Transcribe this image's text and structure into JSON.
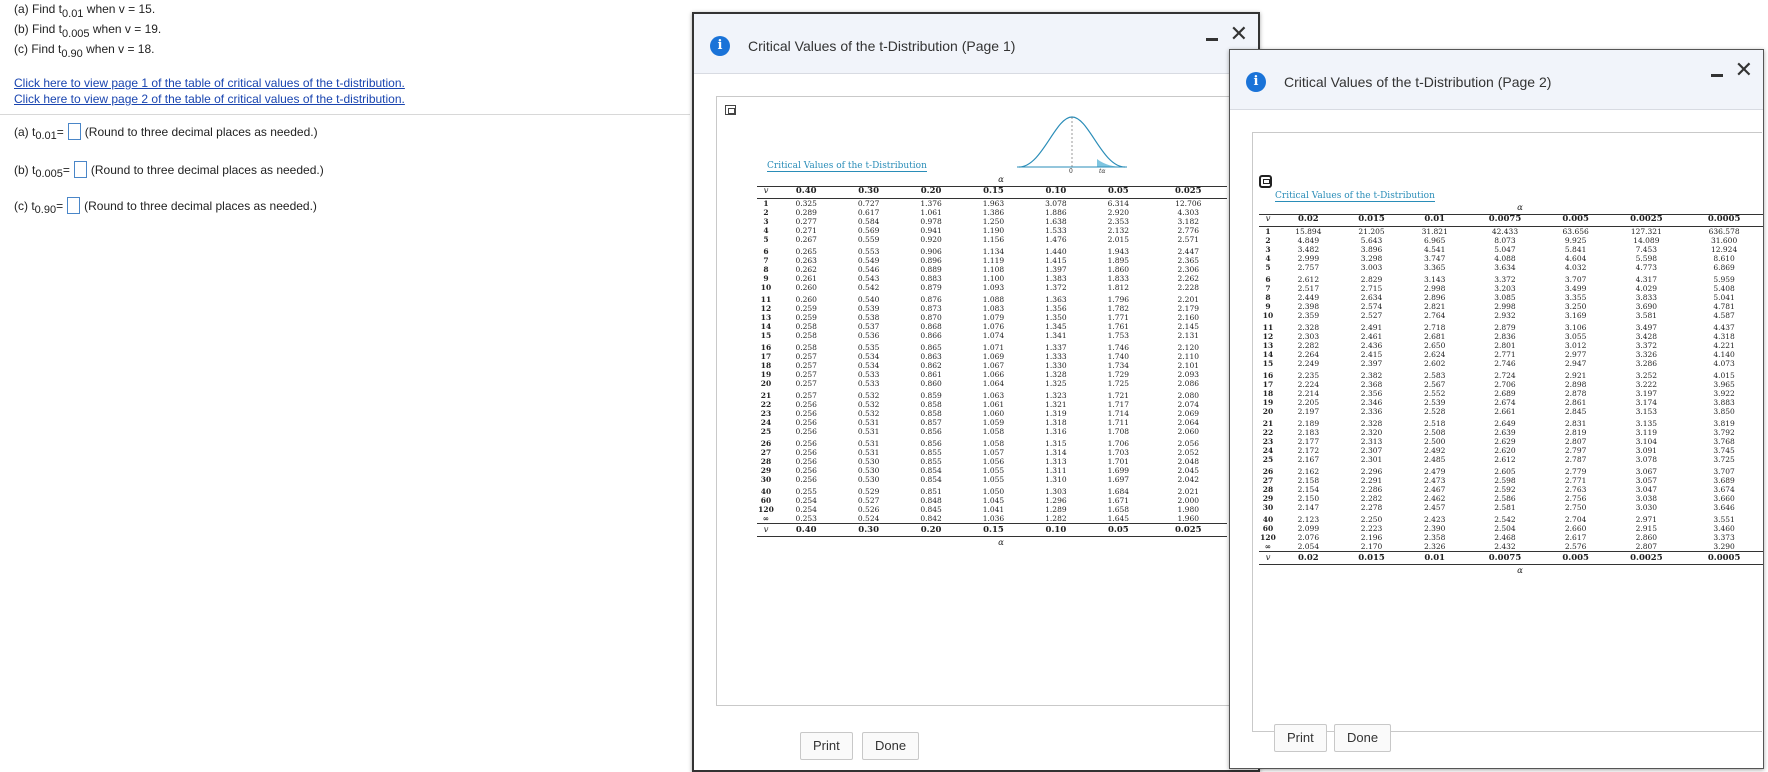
{
  "questions": [
    {
      "prefix": "(a) Find t",
      "sub": "0.01",
      "suffix": " when v = 15."
    },
    {
      "prefix": "(b) Find t",
      "sub": "0.005",
      "suffix": " when v = 19."
    },
    {
      "prefix": "(c) Find t",
      "sub": "0.90",
      "suffix": " when v = 18."
    }
  ],
  "links": [
    "Click here to view page 1 of the table of critical values of the t-distribution.",
    "Click here to view page 2 of the table of critical values of the t-distribution."
  ],
  "answers": [
    {
      "prefix": "(a) t",
      "sub": "0.01",
      "eq": " =",
      "hint": "(Round to three decimal places as needed.)"
    },
    {
      "prefix": "(b) t",
      "sub": "0.005",
      "eq": " =",
      "hint": "(Round to three decimal places as needed.)"
    },
    {
      "prefix": "(c) t",
      "sub": "0.90",
      "eq": " =",
      "hint": "(Round to three decimal places as needed.)"
    }
  ],
  "dialog1": {
    "title": "Critical Values of the t-Distribution (Page 1)",
    "caption": "Critical Values of the t-Distribution",
    "alpha_label": "α",
    "nu_label": "v",
    "curve_labels": [
      "0",
      "tα"
    ],
    "columns": [
      "0.40",
      "0.30",
      "0.20",
      "0.15",
      "0.10",
      "0.05",
      "0.025"
    ],
    "rows": [
      [
        "1",
        "0.325",
        "0.727",
        "1.376",
        "1.963",
        "3.078",
        "6.314",
        "12.706"
      ],
      [
        "2",
        "0.289",
        "0.617",
        "1.061",
        "1.386",
        "1.886",
        "2.920",
        "4.303"
      ],
      [
        "3",
        "0.277",
        "0.584",
        "0.978",
        "1.250",
        "1.638",
        "2.353",
        "3.182"
      ],
      [
        "4",
        "0.271",
        "0.569",
        "0.941",
        "1.190",
        "1.533",
        "2.132",
        "2.776"
      ],
      [
        "5",
        "0.267",
        "0.559",
        "0.920",
        "1.156",
        "1.476",
        "2.015",
        "2.571"
      ],
      [
        "6",
        "0.265",
        "0.553",
        "0.906",
        "1.134",
        "1.440",
        "1.943",
        "2.447"
      ],
      [
        "7",
        "0.263",
        "0.549",
        "0.896",
        "1.119",
        "1.415",
        "1.895",
        "2.365"
      ],
      [
        "8",
        "0.262",
        "0.546",
        "0.889",
        "1.108",
        "1.397",
        "1.860",
        "2.306"
      ],
      [
        "9",
        "0.261",
        "0.543",
        "0.883",
        "1.100",
        "1.383",
        "1.833",
        "2.262"
      ],
      [
        "10",
        "0.260",
        "0.542",
        "0.879",
        "1.093",
        "1.372",
        "1.812",
        "2.228"
      ],
      [
        "11",
        "0.260",
        "0.540",
        "0.876",
        "1.088",
        "1.363",
        "1.796",
        "2.201"
      ],
      [
        "12",
        "0.259",
        "0.539",
        "0.873",
        "1.083",
        "1.356",
        "1.782",
        "2.179"
      ],
      [
        "13",
        "0.259",
        "0.538",
        "0.870",
        "1.079",
        "1.350",
        "1.771",
        "2.160"
      ],
      [
        "14",
        "0.258",
        "0.537",
        "0.868",
        "1.076",
        "1.345",
        "1.761",
        "2.145"
      ],
      [
        "15",
        "0.258",
        "0.536",
        "0.866",
        "1.074",
        "1.341",
        "1.753",
        "2.131"
      ],
      [
        "16",
        "0.258",
        "0.535",
        "0.865",
        "1.071",
        "1.337",
        "1.746",
        "2.120"
      ],
      [
        "17",
        "0.257",
        "0.534",
        "0.863",
        "1.069",
        "1.333",
        "1.740",
        "2.110"
      ],
      [
        "18",
        "0.257",
        "0.534",
        "0.862",
        "1.067",
        "1.330",
        "1.734",
        "2.101"
      ],
      [
        "19",
        "0.257",
        "0.533",
        "0.861",
        "1.066",
        "1.328",
        "1.729",
        "2.093"
      ],
      [
        "20",
        "0.257",
        "0.533",
        "0.860",
        "1.064",
        "1.325",
        "1.725",
        "2.086"
      ],
      [
        "21",
        "0.257",
        "0.532",
        "0.859",
        "1.063",
        "1.323",
        "1.721",
        "2.080"
      ],
      [
        "22",
        "0.256",
        "0.532",
        "0.858",
        "1.061",
        "1.321",
        "1.717",
        "2.074"
      ],
      [
        "23",
        "0.256",
        "0.532",
        "0.858",
        "1.060",
        "1.319",
        "1.714",
        "2.069"
      ],
      [
        "24",
        "0.256",
        "0.531",
        "0.857",
        "1.059",
        "1.318",
        "1.711",
        "2.064"
      ],
      [
        "25",
        "0.256",
        "0.531",
        "0.856",
        "1.058",
        "1.316",
        "1.708",
        "2.060"
      ],
      [
        "26",
        "0.256",
        "0.531",
        "0.856",
        "1.058",
        "1.315",
        "1.706",
        "2.056"
      ],
      [
        "27",
        "0.256",
        "0.531",
        "0.855",
        "1.057",
        "1.314",
        "1.703",
        "2.052"
      ],
      [
        "28",
        "0.256",
        "0.530",
        "0.855",
        "1.056",
        "1.313",
        "1.701",
        "2.048"
      ],
      [
        "29",
        "0.256",
        "0.530",
        "0.854",
        "1.055",
        "1.311",
        "1.699",
        "2.045"
      ],
      [
        "30",
        "0.256",
        "0.530",
        "0.854",
        "1.055",
        "1.310",
        "1.697",
        "2.042"
      ],
      [
        "40",
        "0.255",
        "0.529",
        "0.851",
        "1.050",
        "1.303",
        "1.684",
        "2.021"
      ],
      [
        "60",
        "0.254",
        "0.527",
        "0.848",
        "1.045",
        "1.296",
        "1.671",
        "2.000"
      ],
      [
        "120",
        "0.254",
        "0.526",
        "0.845",
        "1.041",
        "1.289",
        "1.658",
        "1.980"
      ],
      [
        "∞",
        "0.253",
        "0.524",
        "0.842",
        "1.036",
        "1.282",
        "1.645",
        "1.960"
      ]
    ],
    "print_label": "Print",
    "done_label": "Done"
  },
  "dialog2": {
    "title": "Critical Values of the t-Distribution (Page 2)",
    "caption": "Critical Values of the t-Distribution",
    "alpha_label": "α",
    "nu_label": "v",
    "columns": [
      "0.02",
      "0.015",
      "0.01",
      "0.0075",
      "0.005",
      "0.0025",
      "0.0005"
    ],
    "rows": [
      [
        "1",
        "15.894",
        "21.205",
        "31.821",
        "42.433",
        "63.656",
        "127.321",
        "636.578"
      ],
      [
        "2",
        "4.849",
        "5.643",
        "6.965",
        "8.073",
        "9.925",
        "14.089",
        "31.600"
      ],
      [
        "3",
        "3.482",
        "3.896",
        "4.541",
        "5.047",
        "5.841",
        "7.453",
        "12.924"
      ],
      [
        "4",
        "2.999",
        "3.298",
        "3.747",
        "4.088",
        "4.604",
        "5.598",
        "8.610"
      ],
      [
        "5",
        "2.757",
        "3.003",
        "3.365",
        "3.634",
        "4.032",
        "4.773",
        "6.869"
      ],
      [
        "6",
        "2.612",
        "2.829",
        "3.143",
        "3.372",
        "3.707",
        "4.317",
        "5.959"
      ],
      [
        "7",
        "2.517",
        "2.715",
        "2.998",
        "3.203",
        "3.499",
        "4.029",
        "5.408"
      ],
      [
        "8",
        "2.449",
        "2.634",
        "2.896",
        "3.085",
        "3.355",
        "3.833",
        "5.041"
      ],
      [
        "9",
        "2.398",
        "2.574",
        "2.821",
        "2.998",
        "3.250",
        "3.690",
        "4.781"
      ],
      [
        "10",
        "2.359",
        "2.527",
        "2.764",
        "2.932",
        "3.169",
        "3.581",
        "4.587"
      ],
      [
        "11",
        "2.328",
        "2.491",
        "2.718",
        "2.879",
        "3.106",
        "3.497",
        "4.437"
      ],
      [
        "12",
        "2.303",
        "2.461",
        "2.681",
        "2.836",
        "3.055",
        "3.428",
        "4.318"
      ],
      [
        "13",
        "2.282",
        "2.436",
        "2.650",
        "2.801",
        "3.012",
        "3.372",
        "4.221"
      ],
      [
        "14",
        "2.264",
        "2.415",
        "2.624",
        "2.771",
        "2.977",
        "3.326",
        "4.140"
      ],
      [
        "15",
        "2.249",
        "2.397",
        "2.602",
        "2.746",
        "2.947",
        "3.286",
        "4.073"
      ],
      [
        "16",
        "2.235",
        "2.382",
        "2.583",
        "2.724",
        "2.921",
        "3.252",
        "4.015"
      ],
      [
        "17",
        "2.224",
        "2.368",
        "2.567",
        "2.706",
        "2.898",
        "3.222",
        "3.965"
      ],
      [
        "18",
        "2.214",
        "2.356",
        "2.552",
        "2.689",
        "2.878",
        "3.197",
        "3.922"
      ],
      [
        "19",
        "2.205",
        "2.346",
        "2.539",
        "2.674",
        "2.861",
        "3.174",
        "3.883"
      ],
      [
        "20",
        "2.197",
        "2.336",
        "2.528",
        "2.661",
        "2.845",
        "3.153",
        "3.850"
      ],
      [
        "21",
        "2.189",
        "2.328",
        "2.518",
        "2.649",
        "2.831",
        "3.135",
        "3.819"
      ],
      [
        "22",
        "2.183",
        "2.320",
        "2.508",
        "2.639",
        "2.819",
        "3.119",
        "3.792"
      ],
      [
        "23",
        "2.177",
        "2.313",
        "2.500",
        "2.629",
        "2.807",
        "3.104",
        "3.768"
      ],
      [
        "24",
        "2.172",
        "2.307",
        "2.492",
        "2.620",
        "2.797",
        "3.091",
        "3.745"
      ],
      [
        "25",
        "2.167",
        "2.301",
        "2.485",
        "2.612",
        "2.787",
        "3.078",
        "3.725"
      ],
      [
        "26",
        "2.162",
        "2.296",
        "2.479",
        "2.605",
        "2.779",
        "3.067",
        "3.707"
      ],
      [
        "27",
        "2.158",
        "2.291",
        "2.473",
        "2.598",
        "2.771",
        "3.057",
        "3.689"
      ],
      [
        "28",
        "2.154",
        "2.286",
        "2.467",
        "2.592",
        "2.763",
        "3.047",
        "3.674"
      ],
      [
        "29",
        "2.150",
        "2.282",
        "2.462",
        "2.586",
        "2.756",
        "3.038",
        "3.660"
      ],
      [
        "30",
        "2.147",
        "2.278",
        "2.457",
        "2.581",
        "2.750",
        "3.030",
        "3.646"
      ],
      [
        "40",
        "2.123",
        "2.250",
        "2.423",
        "2.542",
        "2.704",
        "2.971",
        "3.551"
      ],
      [
        "60",
        "2.099",
        "2.223",
        "2.390",
        "2.504",
        "2.660",
        "2.915",
        "3.460"
      ],
      [
        "120",
        "2.076",
        "2.196",
        "2.358",
        "2.468",
        "2.617",
        "2.860",
        "3.373"
      ],
      [
        "∞",
        "2.054",
        "2.170",
        "2.326",
        "2.432",
        "2.576",
        "2.807",
        "3.290"
      ]
    ],
    "print_label": "Print",
    "done_label": "Done"
  },
  "colors": {
    "link": "#1a45b0",
    "info_icon": "#1a73d8",
    "table_caption": "#2a8db8",
    "input_border": "#4a86c8"
  },
  "icons": [
    "info-icon",
    "minimize-icon",
    "close-icon",
    "expand-icon"
  ]
}
